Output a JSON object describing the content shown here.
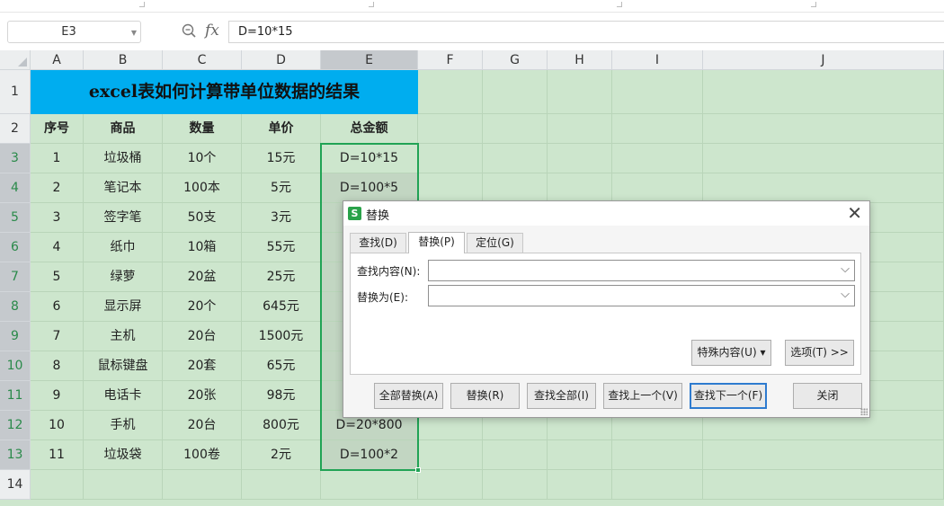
{
  "formula_bar": {
    "name_box": "E3",
    "fx_label": "fx",
    "formula": "D=10*15"
  },
  "columns": [
    "A",
    "B",
    "C",
    "D",
    "E",
    "F",
    "G",
    "H",
    "I",
    "J"
  ],
  "rows": [
    "1",
    "2",
    "3",
    "4",
    "5",
    "6",
    "7",
    "8",
    "9",
    "10",
    "11",
    "12",
    "13",
    "14"
  ],
  "sheet": {
    "title": "excel表如何计算带单位数据的结果",
    "headers": [
      "序号",
      "商品",
      "数量",
      "单价",
      "总金额"
    ],
    "data": [
      [
        "1",
        "垃圾桶",
        "10个",
        "15元",
        "D=10*15"
      ],
      [
        "2",
        "笔记本",
        "100本",
        "5元",
        "D=100*5"
      ],
      [
        "3",
        "签字笔",
        "50支",
        "3元",
        ""
      ],
      [
        "4",
        "纸巾",
        "10箱",
        "55元",
        ""
      ],
      [
        "5",
        "绿萝",
        "20盆",
        "25元",
        ""
      ],
      [
        "6",
        "显示屏",
        "20个",
        "645元",
        "I"
      ],
      [
        "7",
        "主机",
        "20台",
        "1500元",
        "D"
      ],
      [
        "8",
        "鼠标键盘",
        "20套",
        "65元",
        ""
      ],
      [
        "9",
        "电话卡",
        "20张",
        "98元",
        ""
      ],
      [
        "10",
        "手机",
        "20台",
        "800元",
        "D=20*800"
      ],
      [
        "11",
        "垃圾袋",
        "100卷",
        "2元",
        "D=100*2"
      ]
    ]
  },
  "dialog": {
    "title": "替换",
    "icon_letter": "S",
    "close_glyph": "✕",
    "tabs": [
      "查找(D)",
      "替换(P)",
      "定位(G)"
    ],
    "active_tab": "替换(P)",
    "find_label": "查找内容(N):",
    "find_value": "",
    "replace_label": "替换为(E):",
    "replace_value": "",
    "special_button": "特殊内容(U) ▾",
    "options_button": "选项(T) >>",
    "buttons": {
      "replace_all": "全部替换(A)",
      "replace": "替换(R)",
      "find_all": "查找全部(I)",
      "find_prev": "查找上一个(V)",
      "find_next": "查找下一个(F)",
      "close": "关闭"
    },
    "chevron": "⌵"
  }
}
